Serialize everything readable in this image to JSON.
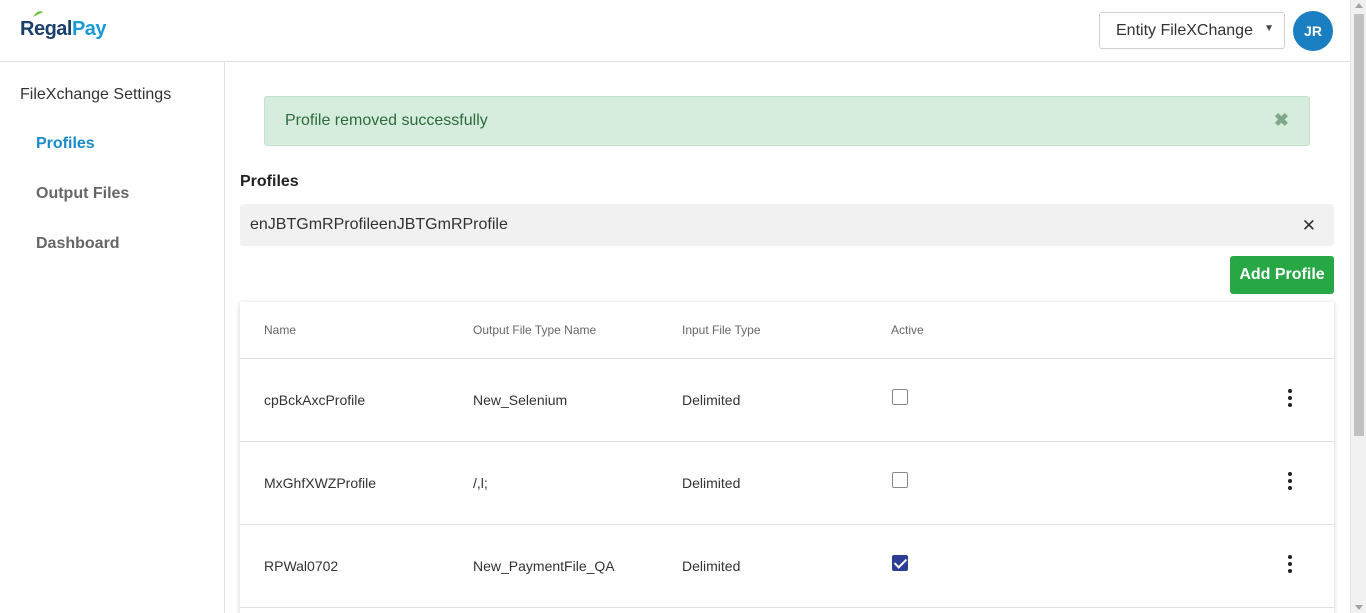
{
  "header": {
    "logo_part1": "Regal",
    "logo_part2": "Pay",
    "entity_select_value": "Entity FileXChange",
    "avatar_initials": "JR"
  },
  "sidebar": {
    "heading": "FileXchange Settings",
    "items": [
      {
        "label": "Profiles",
        "active": true
      },
      {
        "label": "Output Files",
        "active": false
      },
      {
        "label": "Dashboard",
        "active": false
      }
    ]
  },
  "alert": {
    "message": "Profile removed successfully",
    "close_glyph": "✖"
  },
  "profiles": {
    "title": "Profiles",
    "search_value": "enJBTGmRProfileenJBTGmRProfile",
    "clear_glyph": "✕",
    "add_button_label": "Add Profile"
  },
  "table": {
    "columns": [
      "Name",
      "Output File Type Name",
      "Input File Type",
      "Active"
    ],
    "rows": [
      {
        "name": "cpBckAxcProfile",
        "output_file_type": "New_Selenium",
        "input_file_type": "Delimited",
        "active": false
      },
      {
        "name": "MxGhfXWZProfile",
        "output_file_type": "/,l;",
        "input_file_type": "Delimited",
        "active": false
      },
      {
        "name": "RPWal0702",
        "output_file_type": "New_PaymentFile_QA",
        "input_file_type": "Delimited",
        "active": true
      }
    ]
  },
  "colors": {
    "brand_dark": "#1b3f6b",
    "brand_light": "#1a9ad6",
    "success": "#28a745",
    "alert_bg": "#d6ecdd",
    "checkbox_checked": "#2a3f94"
  }
}
